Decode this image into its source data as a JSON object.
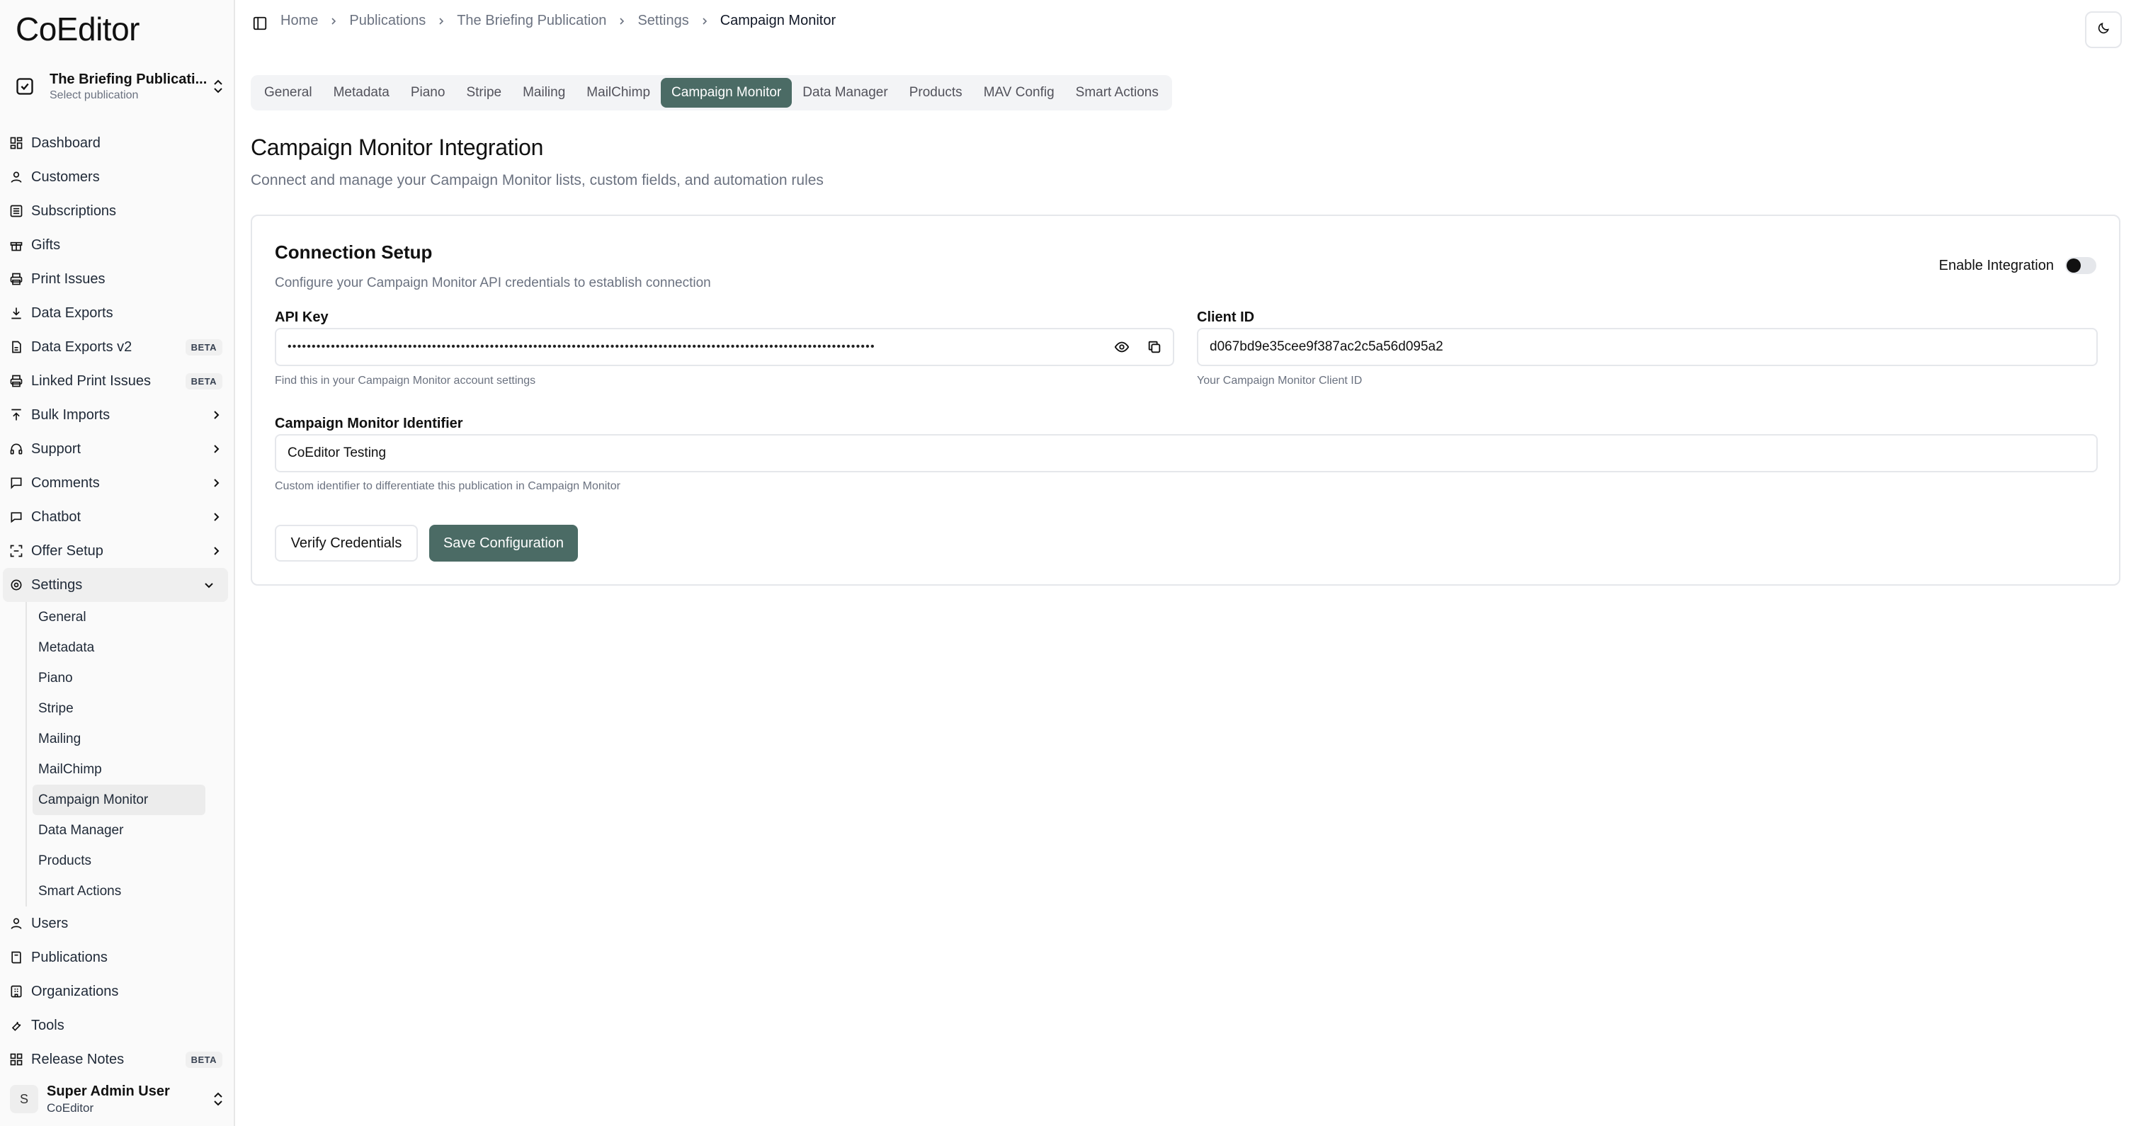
{
  "app": {
    "brand": "CoEditor"
  },
  "publication": {
    "name": "The Briefing Publicati...",
    "subtitle": "Select publication"
  },
  "sidebar": {
    "items": [
      {
        "label": "Dashboard"
      },
      {
        "label": "Customers"
      },
      {
        "label": "Subscriptions"
      },
      {
        "label": "Gifts"
      },
      {
        "label": "Print Issues"
      },
      {
        "label": "Data Exports"
      },
      {
        "label": "Data Exports v2",
        "badge": "BETA"
      },
      {
        "label": "Linked Print Issues",
        "badge": "BETA"
      },
      {
        "label": "Bulk Imports"
      },
      {
        "label": "Support"
      },
      {
        "label": "Comments"
      },
      {
        "label": "Chatbot"
      },
      {
        "label": "Offer Setup"
      },
      {
        "label": "Settings"
      },
      {
        "label": "Users"
      },
      {
        "label": "Publications"
      },
      {
        "label": "Organizations"
      },
      {
        "label": "Tools"
      },
      {
        "label": "Release Notes",
        "badge": "BETA"
      }
    ],
    "settings_sub": [
      "General",
      "Metadata",
      "Piano",
      "Stripe",
      "Mailing",
      "MailChimp",
      "Campaign Monitor",
      "Data Manager",
      "Products",
      "Smart Actions"
    ]
  },
  "user": {
    "initial": "S",
    "name": "Super Admin User",
    "org": "CoEditor"
  },
  "breadcrumbs": [
    "Home",
    "Publications",
    "The Briefing Publication",
    "Settings",
    "Campaign Monitor"
  ],
  "tabs": [
    "General",
    "Metadata",
    "Piano",
    "Stripe",
    "Mailing",
    "MailChimp",
    "Campaign Monitor",
    "Data Manager",
    "Products",
    "MAV Config",
    "Smart Actions"
  ],
  "page": {
    "title": "Campaign Monitor Integration",
    "subtitle": "Connect and manage your Campaign Monitor lists, custom fields, and automation rules"
  },
  "connection": {
    "title": "Connection Setup",
    "description": "Configure your Campaign Monitor API credentials to establish connection",
    "enable_label": "Enable Integration",
    "api_key_label": "API Key",
    "api_key_mask": "••••••••••••••••••••••••••••••••••••••••••••••••••••••••••••••••••••••••••••••••••••••••••••••••••••••••••••••••••••••••••",
    "api_key_help": "Find this in your Campaign Monitor account settings",
    "client_id_label": "Client ID",
    "client_id_value": "d067bd9e35cee9f387ac2c5a56d095a2",
    "client_id_help": "Your Campaign Monitor Client ID",
    "identifier_label": "Campaign Monitor Identifier",
    "identifier_value": "CoEditor Testing",
    "identifier_help": "Custom identifier to differentiate this publication in Campaign Monitor",
    "verify_label": "Verify Credentials",
    "save_label": "Save Configuration"
  },
  "colors": {
    "accent": "#4b6b65",
    "muted_text": "#6b7280",
    "border": "#e5e7eb"
  }
}
